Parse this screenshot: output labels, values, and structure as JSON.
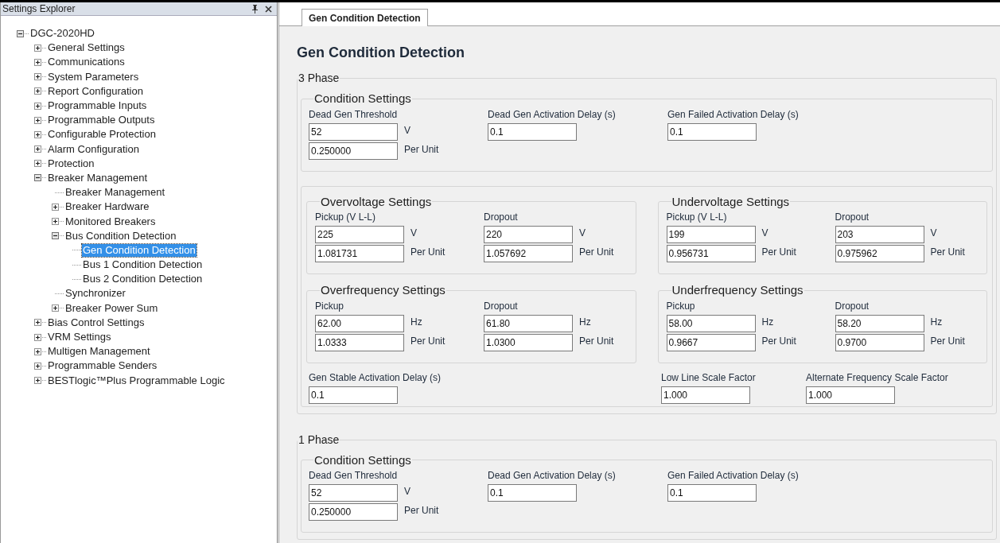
{
  "explorer": {
    "title": "Settings Explorer",
    "tree": [
      {
        "label": "DGC-2020HD",
        "kind": "node",
        "expanded": true,
        "selected": false,
        "children": [
          {
            "label": "General Settings",
            "kind": "node",
            "expanded": false,
            "selected": false
          },
          {
            "label": "Communications",
            "kind": "node",
            "expanded": false,
            "selected": false
          },
          {
            "label": "System Parameters",
            "kind": "node",
            "expanded": false,
            "selected": false
          },
          {
            "label": "Report Configuration",
            "kind": "node",
            "expanded": false,
            "selected": false
          },
          {
            "label": "Programmable Inputs",
            "kind": "node",
            "expanded": false,
            "selected": false
          },
          {
            "label": "Programmable Outputs",
            "kind": "node",
            "expanded": false,
            "selected": false
          },
          {
            "label": "Configurable Protection",
            "kind": "node",
            "expanded": false,
            "selected": false
          },
          {
            "label": "Alarm Configuration",
            "kind": "node",
            "expanded": false,
            "selected": false
          },
          {
            "label": "Protection",
            "kind": "node",
            "expanded": false,
            "selected": false
          },
          {
            "label": "Breaker Management",
            "kind": "node",
            "expanded": true,
            "selected": false,
            "children": [
              {
                "label": "Breaker Management",
                "kind": "leaf",
                "selected": false
              },
              {
                "label": "Breaker Hardware",
                "kind": "node",
                "expanded": false,
                "selected": false
              },
              {
                "label": "Monitored Breakers",
                "kind": "node",
                "expanded": false,
                "selected": false
              },
              {
                "label": "Bus Condition Detection",
                "kind": "node",
                "expanded": true,
                "selected": false,
                "children": [
                  {
                    "label": "Gen Condition Detection",
                    "kind": "leaf",
                    "selected": true
                  },
                  {
                    "label": "Bus 1 Condition Detection",
                    "kind": "leaf",
                    "selected": false
                  },
                  {
                    "label": "Bus 2 Condition Detection",
                    "kind": "leaf",
                    "selected": false
                  }
                ]
              },
              {
                "label": "Synchronizer",
                "kind": "leaf",
                "selected": false
              },
              {
                "label": "Breaker Power Sum",
                "kind": "node",
                "expanded": false,
                "selected": false
              }
            ]
          },
          {
            "label": "Bias Control Settings",
            "kind": "node",
            "expanded": false,
            "selected": false
          },
          {
            "label": "VRM Settings",
            "kind": "node",
            "expanded": false,
            "selected": false
          },
          {
            "label": "Multigen Management",
            "kind": "node",
            "expanded": false,
            "selected": false
          },
          {
            "label": "Programmable Senders",
            "kind": "node",
            "expanded": false,
            "selected": false
          },
          {
            "label": "BESTlogic™Plus Programmable Logic",
            "kind": "node",
            "expanded": false,
            "selected": false
          }
        ]
      }
    ]
  },
  "tabs": [
    {
      "label": "Gen Condition Detection",
      "selected": true
    }
  ],
  "heading": "Gen Condition Detection",
  "sections": [
    {
      "title": "3 Phase",
      "condition": {
        "title": "Condition Settings",
        "fields": [
          {
            "label": "Dead Gen Threshold",
            "inputs": [
              {
                "value": "52",
                "unit": "V"
              },
              {
                "value": "0.250000",
                "unit": "Per Unit"
              }
            ]
          },
          {
            "label": "Dead Gen Activation Delay (s)",
            "inputs": [
              {
                "value": "0.1"
              }
            ]
          },
          {
            "label": "Gen Failed Activation Delay (s)",
            "inputs": [
              {
                "value": "0.1"
              }
            ]
          }
        ]
      },
      "limits": [
        {
          "title": "Overvoltage Settings",
          "fields": [
            {
              "label": "Pickup (V L-L)",
              "inputs": [
                {
                  "value": "225",
                  "unit": "V"
                },
                {
                  "value": "1.081731",
                  "unit": "Per Unit"
                }
              ]
            },
            {
              "label": "Dropout",
              "inputs": [
                {
                  "value": "220",
                  "unit": "V"
                },
                {
                  "value": "1.057692",
                  "unit": "Per Unit"
                }
              ]
            }
          ]
        },
        {
          "title": "Undervoltage Settings",
          "fields": [
            {
              "label": "Pickup (V L-L)",
              "inputs": [
                {
                  "value": "199",
                  "unit": "V"
                },
                {
                  "value": "0.956731",
                  "unit": "Per Unit"
                }
              ]
            },
            {
              "label": "Dropout",
              "inputs": [
                {
                  "value": "203",
                  "unit": "V"
                },
                {
                  "value": "0.975962",
                  "unit": "Per Unit"
                }
              ]
            }
          ]
        },
        {
          "title": "Overfrequency Settings",
          "fields": [
            {
              "label": "Pickup",
              "inputs": [
                {
                  "value": "62.00",
                  "unit": "Hz"
                },
                {
                  "value": "1.0333",
                  "unit": "Per Unit"
                }
              ]
            },
            {
              "label": "Dropout",
              "inputs": [
                {
                  "value": "61.80",
                  "unit": "Hz"
                },
                {
                  "value": "1.0300",
                  "unit": "Per Unit"
                }
              ]
            }
          ]
        },
        {
          "title": "Underfrequency Settings",
          "fields": [
            {
              "label": "Pickup",
              "inputs": [
                {
                  "value": "58.00",
                  "unit": "Hz"
                },
                {
                  "value": "0.9667",
                  "unit": "Per Unit"
                }
              ]
            },
            {
              "label": "Dropout",
              "inputs": [
                {
                  "value": "58.20",
                  "unit": "Hz"
                },
                {
                  "value": "0.9700",
                  "unit": "Per Unit"
                }
              ]
            }
          ]
        }
      ],
      "extra": [
        {
          "label": "Gen Stable Activation Delay (s)",
          "inputs": [
            {
              "value": "0.1"
            }
          ]
        },
        {
          "label": "Low Line Scale Factor",
          "inputs": [
            {
              "value": "1.000"
            }
          ]
        },
        {
          "label": "Alternate Frequency Scale Factor",
          "inputs": [
            {
              "value": "1.000"
            }
          ]
        }
      ]
    },
    {
      "title": "1 Phase",
      "condition": {
        "title": "Condition Settings",
        "fields": [
          {
            "label": "Dead Gen Threshold",
            "inputs": [
              {
                "value": "52",
                "unit": "V"
              },
              {
                "value": "0.250000",
                "unit": "Per Unit"
              }
            ]
          },
          {
            "label": "Dead Gen Activation Delay (s)",
            "inputs": [
              {
                "value": "0.1"
              }
            ]
          },
          {
            "label": "Gen Failed Activation Delay (s)",
            "inputs": [
              {
                "value": "0.1"
              }
            ]
          }
        ]
      }
    }
  ]
}
